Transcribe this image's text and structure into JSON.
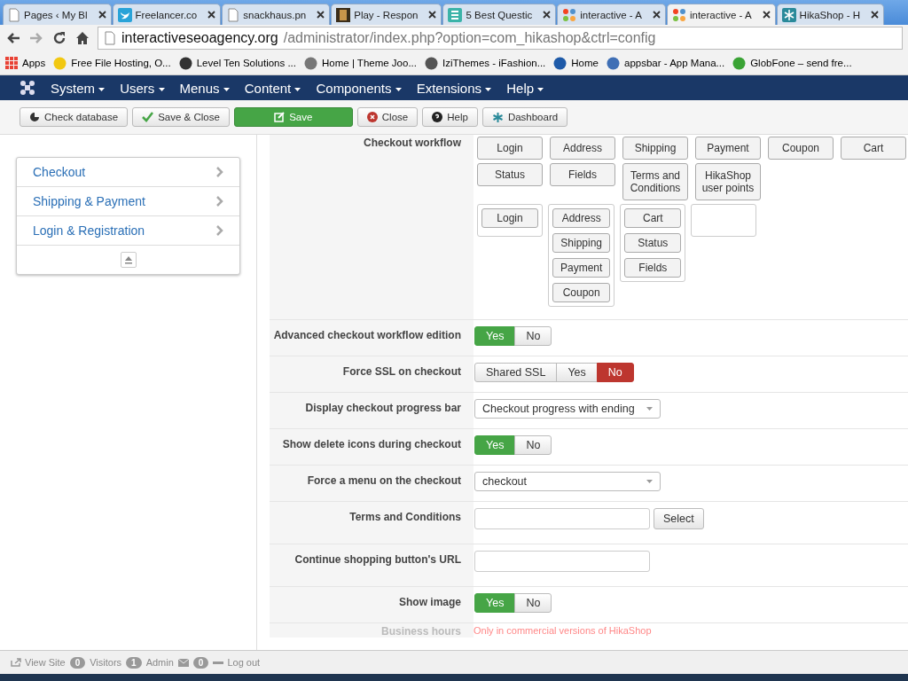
{
  "browser": {
    "tabs": [
      {
        "title": "Pages ‹ My Bl",
        "kind": "page",
        "selected": false
      },
      {
        "title": "Freelancer.co",
        "kind": "bird",
        "selected": false
      },
      {
        "title": "snackhaus.pn",
        "kind": "page",
        "selected": false
      },
      {
        "title": "Play - Respon",
        "kind": "image",
        "selected": false
      },
      {
        "title": "5 Best Questic",
        "kind": "list",
        "selected": false
      },
      {
        "title": "interactive - A",
        "kind": "joomla",
        "selected": false
      },
      {
        "title": "interactive - A",
        "kind": "joomla",
        "selected": true
      },
      {
        "title": "HikaShop - H",
        "kind": "snowflake",
        "selected": false
      }
    ],
    "url_host": "interactiveseoagency.org",
    "url_path": "/administrator/index.php?option=com_hikashop&ctrl=config",
    "bookmarks": [
      {
        "label": "Apps",
        "color": "#e94235"
      },
      {
        "label": "Free File Hosting, O...",
        "color": "#f2c811"
      },
      {
        "label": "Level Ten Solutions ...",
        "color": "#333333"
      },
      {
        "label": "Home | Theme Joo...",
        "color": "#777777"
      },
      {
        "label": "IziThemes - iFashion...",
        "color": "#555555"
      },
      {
        "label": "Home",
        "color": "#1e5aa8"
      },
      {
        "label": "appsbar - App Mana...",
        "color": "#3f6fb5"
      },
      {
        "label": "GlobFone – send fre...",
        "color": "#3aa335"
      }
    ]
  },
  "menu": [
    "System",
    "Users",
    "Menus",
    "Content",
    "Components",
    "Extensions",
    "Help"
  ],
  "toolbar": [
    {
      "label": "Check database",
      "kind": "check"
    },
    {
      "label": "Save & Close",
      "kind": "saveclose"
    },
    {
      "label": "Save",
      "kind": "save"
    },
    {
      "label": "Close",
      "kind": "close"
    },
    {
      "label": "Help",
      "kind": "help"
    },
    {
      "label": "Dashboard",
      "kind": "dashboard"
    }
  ],
  "sidebar": [
    "Checkout",
    "Shipping & Payment",
    "Login & Registration"
  ],
  "workflow": {
    "label": "Checkout workflow",
    "blocks": [
      "Login",
      "Address",
      "Shipping",
      "Payment",
      "Coupon",
      "Cart",
      "Status",
      "Fields",
      "Terms and Conditions",
      "HikaShop user points"
    ],
    "steps": [
      [
        "Login"
      ],
      [
        "Address",
        "Shipping",
        "Payment",
        "Coupon"
      ],
      [
        "Cart",
        "Status",
        "Fields"
      ]
    ]
  },
  "settings": [
    {
      "label": "Advanced checkout workflow edition",
      "kind": "toggle",
      "color": "#46a546",
      "options": [
        {
          "label": "Yes",
          "selected": true
        },
        {
          "label": "No",
          "selected": false
        }
      ]
    },
    {
      "label": "Force SSL on checkout",
      "kind": "toggle",
      "color": "#bd362f",
      "options": [
        {
          "label": "Shared SSL",
          "selected": false
        },
        {
          "label": "Yes",
          "selected": false
        },
        {
          "label": "No",
          "selected": true
        }
      ]
    },
    {
      "label": "Display checkout progress bar",
      "kind": "select",
      "value": "Checkout progress with ending"
    },
    {
      "label": "Show delete icons during checkout",
      "kind": "toggle",
      "color": "#46a546",
      "options": [
        {
          "label": "Yes",
          "selected": true
        },
        {
          "label": "No",
          "selected": false
        }
      ]
    },
    {
      "label": "Force a menu on the checkout",
      "kind": "select",
      "value": "checkout"
    },
    {
      "label": "Terms and Conditions",
      "kind": "input_button",
      "button": "Select"
    },
    {
      "label": "Continue shopping button's URL",
      "kind": "input"
    },
    {
      "label": "Show image",
      "kind": "toggle",
      "color": "#46a546",
      "options": [
        {
          "label": "Yes",
          "selected": true
        },
        {
          "label": "No",
          "selected": false
        }
      ]
    },
    {
      "label": "Business hours",
      "kind": "note",
      "note": "Only in commercial versions of HikaShop"
    }
  ],
  "status_bar": {
    "view_site": "View Site",
    "visitors_count": "0",
    "visitors": "Visitors",
    "admin_count": "1",
    "admin": "Admin",
    "messages_count": "0",
    "logout": "Log out"
  }
}
